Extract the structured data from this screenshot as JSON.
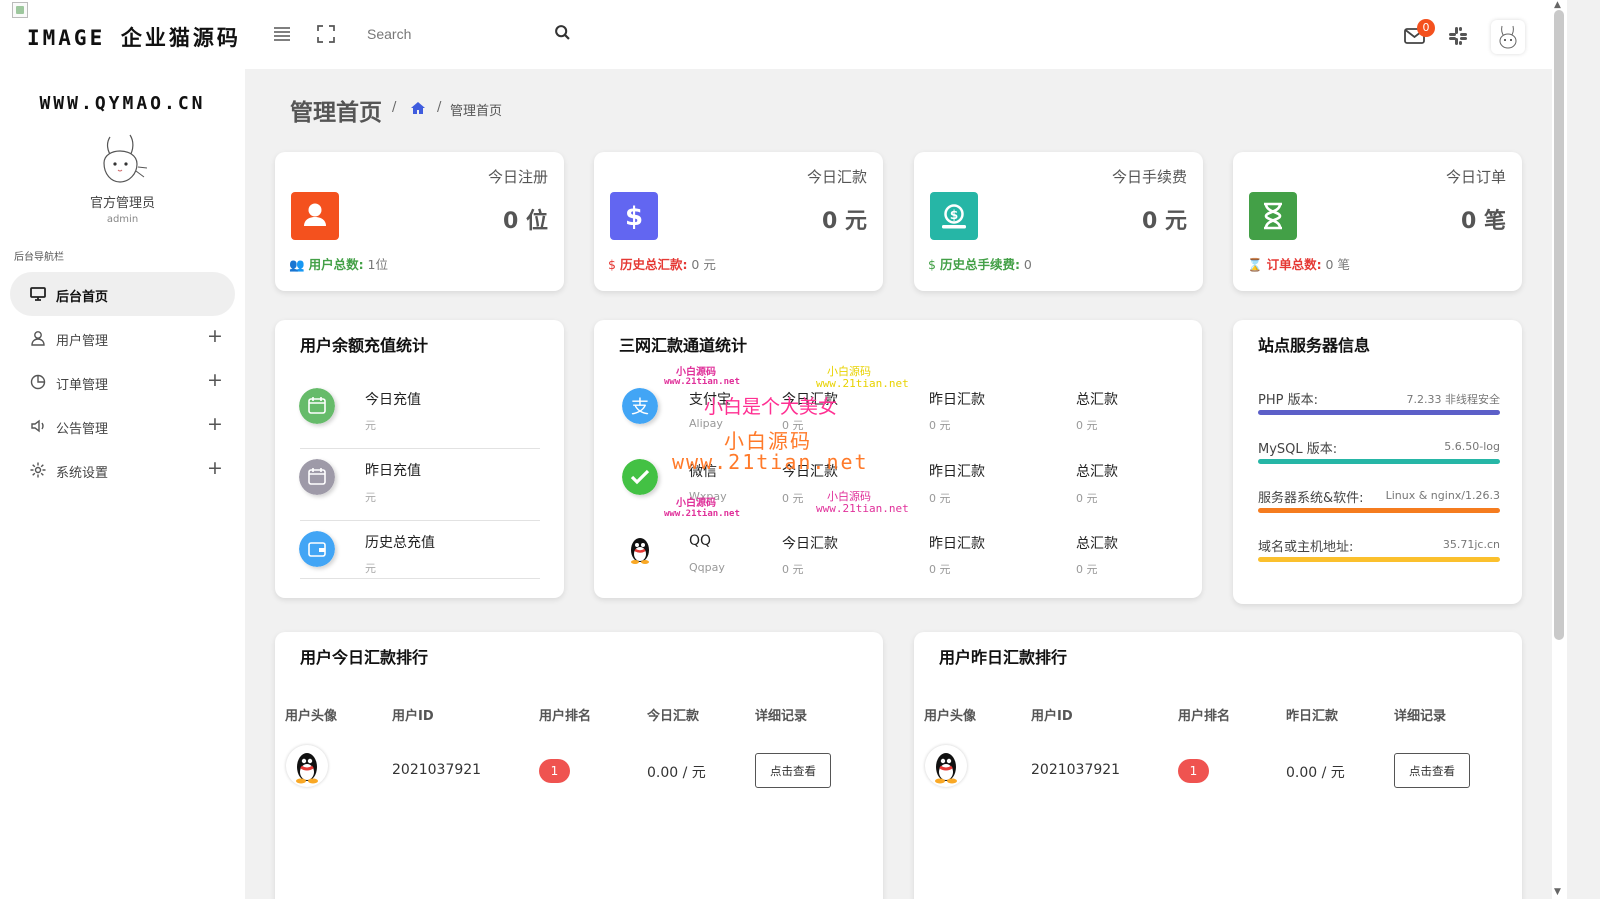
{
  "header": {
    "brand": "IMAGE 企业猫源码",
    "search_placeholder": "Search",
    "mail_count": "0"
  },
  "sidebar": {
    "site_url": "WWW.QYMAO.CN",
    "admin_name": "官方管理员",
    "admin_role": "admin",
    "nav_label": "后台导航栏",
    "items": [
      {
        "label": "后台首页"
      },
      {
        "label": "用户管理",
        "expand": "+"
      },
      {
        "label": "订单管理",
        "expand": "+"
      },
      {
        "label": "公告管理",
        "expand": "+"
      },
      {
        "label": "系统设置",
        "expand": "+"
      }
    ]
  },
  "breadcrumb": {
    "title": "管理首页",
    "sep": "/",
    "current": "管理首页"
  },
  "stats": [
    {
      "title": "今日注册",
      "value": "0 位",
      "foot_label": "用户总数:",
      "foot_value": "1位",
      "color": "#f4511e",
      "foot_color": "#43a047",
      "icon": "user-icon"
    },
    {
      "title": "今日汇款",
      "value": "0 元",
      "foot_label": "历史总汇款:",
      "foot_value": "0 元",
      "color": "#6266f1",
      "foot_color": "#e53935",
      "icon": "dollar-icon"
    },
    {
      "title": "今日手续费",
      "value": "0 元",
      "foot_label": "历史总手续费:",
      "foot_value": "0",
      "color": "#26b6a6",
      "foot_color": "#43a047",
      "icon": "money-icon"
    },
    {
      "title": "今日订单",
      "value": "0 笔",
      "foot_label": "订单总数:",
      "foot_value": "0 笔",
      "color": "#43a047",
      "foot_color": "#e53935",
      "icon": "hourglass-icon"
    }
  ],
  "recharge": {
    "title": "用户余额充值统计",
    "rows": [
      {
        "name": "今日充值",
        "unit": "元"
      },
      {
        "name": "昨日充值",
        "unit": "元"
      },
      {
        "name": "历史总充值",
        "unit": "元"
      }
    ]
  },
  "channels": {
    "title": "三网汇款通道统计",
    "rows": [
      {
        "name": "支付宝",
        "sub": "Alipay",
        "c1": "今日汇款",
        "v1": "0 元",
        "c2": "昨日汇款",
        "v2": "0 元",
        "c3": "总汇款",
        "v3": "0 元"
      },
      {
        "name": "微信",
        "sub": "Wxpay",
        "c1": "今日汇款",
        "v1": "0 元",
        "c2": "昨日汇款",
        "v2": "0 元",
        "c3": "总汇款",
        "v3": "0 元"
      },
      {
        "name": "QQ",
        "sub": "Qqpay",
        "c1": "今日汇款",
        "v1": "0 元",
        "c2": "昨日汇款",
        "v2": "0 元",
        "c3": "总汇款",
        "v3": "0 元"
      }
    ]
  },
  "server": {
    "title": "站点服务器信息",
    "rows": [
      {
        "label": "PHP 版本:",
        "value": "7.2.33 非线程安全",
        "color": "#5c5fc8"
      },
      {
        "label": "MySQL 版本:",
        "value": "5.6.50-log",
        "color": "#26b6a6"
      },
      {
        "label": "服务器系统&软件:",
        "value": "Linux & nginx/1.26.3",
        "color": "#f57c1f"
      },
      {
        "label": "域名或主机地址:",
        "value": "35.71jc.cn",
        "color": "#fbc02d"
      }
    ]
  },
  "rank_today": {
    "title": "用户今日汇款排行",
    "headers": [
      "用户头像",
      "用户ID",
      "用户排名",
      "今日汇款",
      "详细记录"
    ],
    "row": {
      "id": "2021037921",
      "rank": "1",
      "amount": "0.00 / 元",
      "action": "点击查看"
    }
  },
  "rank_yesterday": {
    "title": "用户昨日汇款排行",
    "headers": [
      "用户头像",
      "用户ID",
      "用户排名",
      "昨日汇款",
      "详细记录"
    ],
    "row": {
      "id": "2021037921",
      "rank": "1",
      "amount": "0.00 / 元",
      "action": "点击查看"
    }
  },
  "watermark": {
    "small_cn": "小白源码",
    "small_url": "www.21tian.net",
    "phrase": "小白是个大美女",
    "big_cn": "小白源码",
    "big_url": "www.21tian.net"
  }
}
